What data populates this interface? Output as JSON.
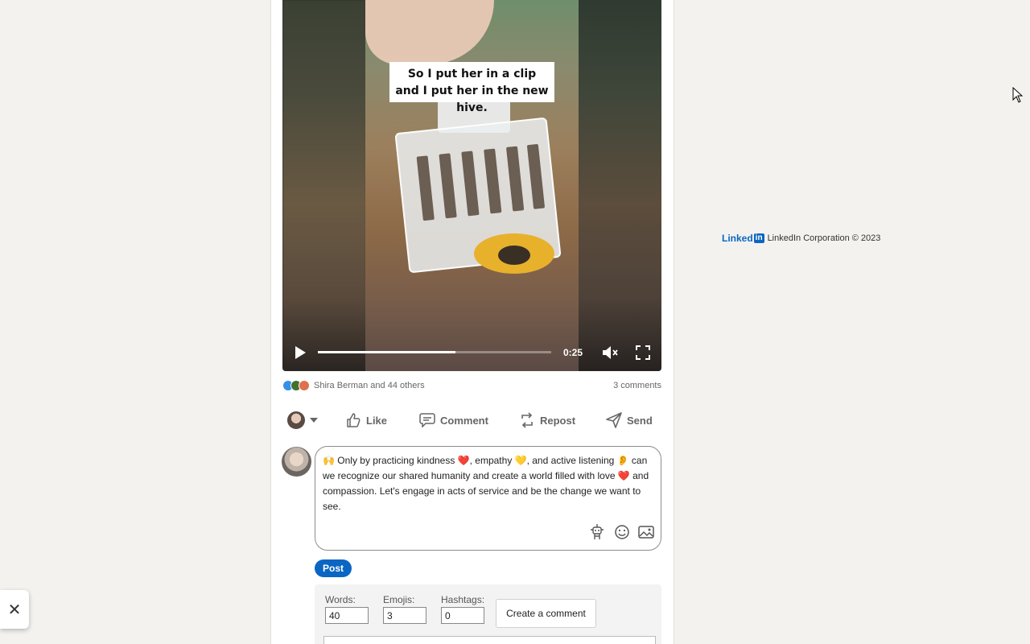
{
  "video": {
    "caption": "So I put her in a clip and I put her in the new hive.",
    "time": "0:25",
    "progress_fraction": 0.59
  },
  "social": {
    "reactions": [
      "like-icon",
      "celebrate-icon",
      "love-icon"
    ],
    "reactors_text": "Shira Berman and 44 others",
    "comments_text": "3 comments"
  },
  "actions": {
    "like": "Like",
    "comment": "Comment",
    "repost": "Repost",
    "send": "Send"
  },
  "comment_box": {
    "text": "🙌 Only by practicing kindness ❤️, empathy 💛, and active listening 👂 can we recognize our shared humanity and create a world filled with love ❤️ and compassion. Let's engage in acts of service and be the change we want to see."
  },
  "post_button": "Post",
  "generator": {
    "words_label": "Words:",
    "words_value": "40",
    "emojis_label": "Emojis:",
    "emojis_value": "3",
    "hashtags_label": "Hashtags:",
    "hashtags_value": "0",
    "create_label": "Create a comment"
  },
  "footer": {
    "logo_text": "Linked",
    "logo_in": "in",
    "copyright": "LinkedIn Corporation © 2023"
  },
  "toast": {
    "close_glyph": "✕"
  }
}
